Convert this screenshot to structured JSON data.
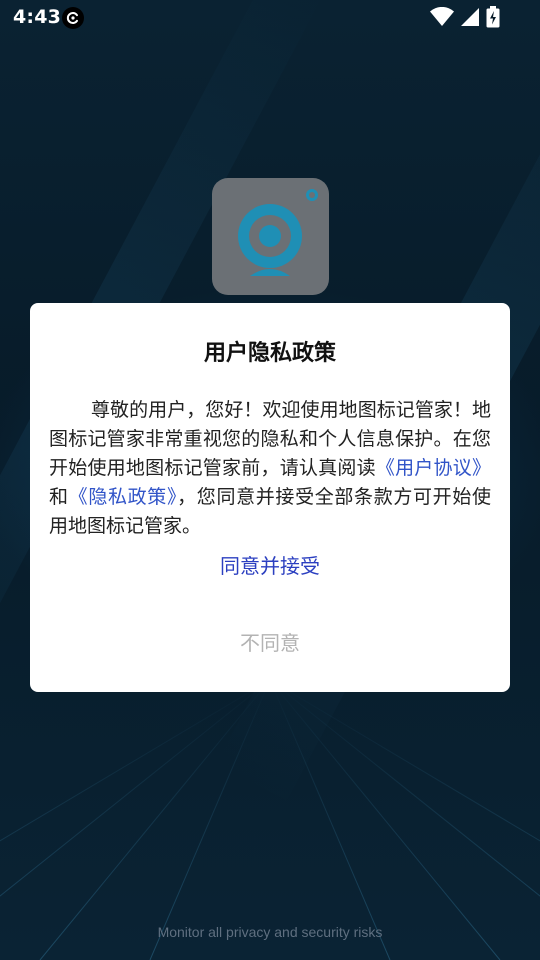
{
  "status_bar": {
    "time": "4:43",
    "icons": [
      "notification-c-icon",
      "wifi-icon",
      "cell-signal-icon",
      "battery-charging-icon"
    ]
  },
  "app_icon": {
    "name": "webcam-icon",
    "bg_color": "#6b7075",
    "lens_color": "#1f8fb5"
  },
  "dialog": {
    "title": "用户隐私政策",
    "body_intro": "尊敬的用户，您好！欢迎使用地图标记管家！地图标记管家非常重视您的隐私和个人信息保护。在您开始使用地图标记管家前，请认真阅读",
    "link_user_agreement": "《用户协议》",
    "body_and": "和",
    "link_privacy_policy": "《隐私政策》",
    "body_outro": "，您同意并接受全部条款方可开始使用地图标记管家。",
    "agree_label": "同意并接受",
    "disagree_label": "不同意"
  },
  "footer": {
    "tagline": "Monitor all privacy and security risks"
  },
  "colors": {
    "background": "#071a28",
    "link": "#3154c8",
    "agree": "#2b3fc0",
    "disagree": "#b3b3b3"
  }
}
